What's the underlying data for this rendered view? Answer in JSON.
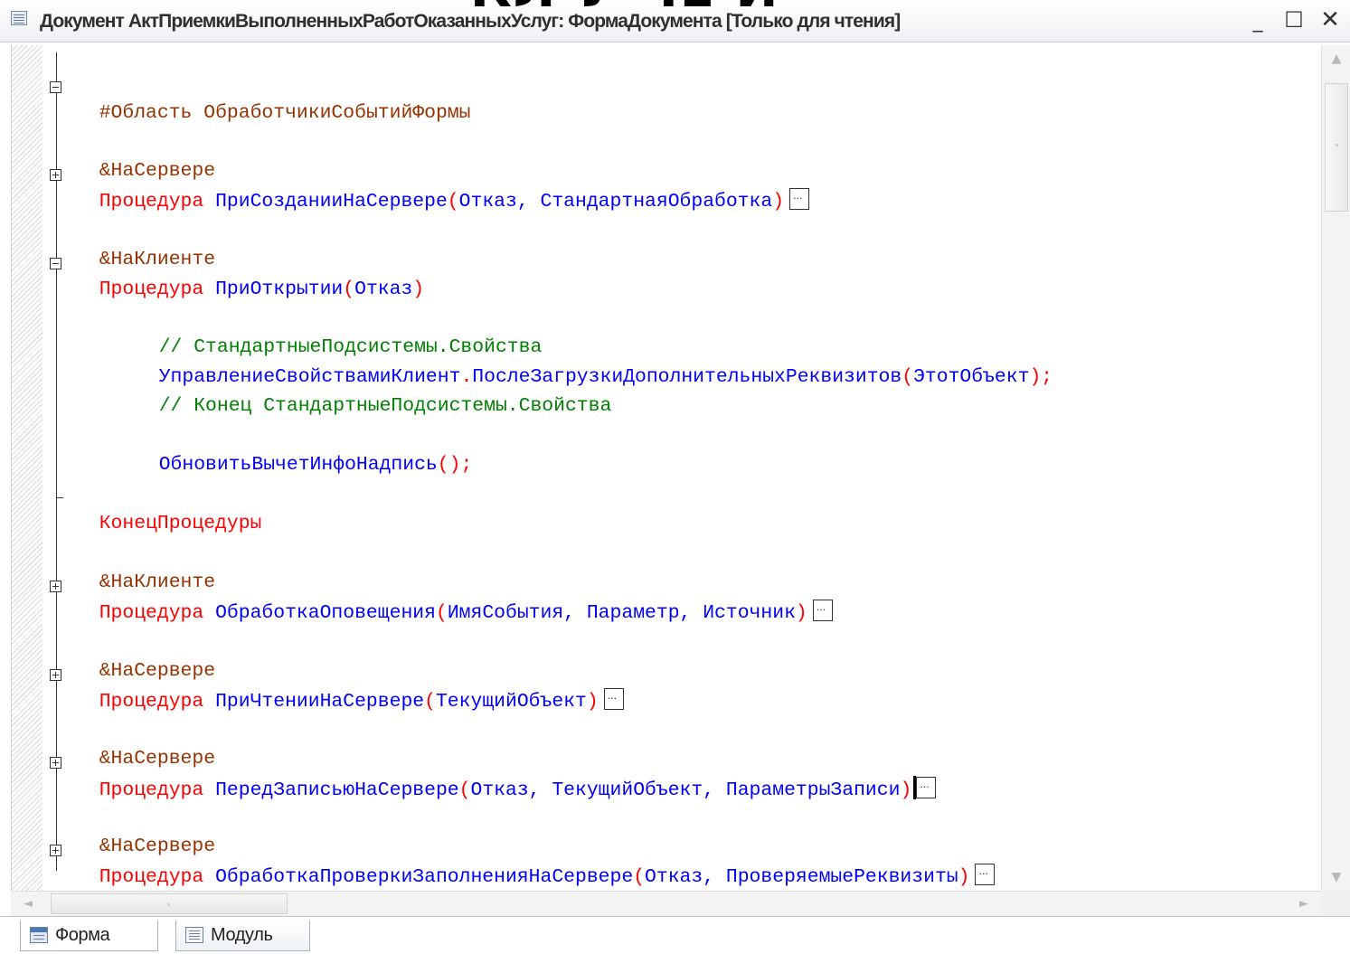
{
  "window": {
    "title": "Документ АктПриемкиВыполненныхРаботОказанныхУслуг: ФормаДокумента [Только для чтения]",
    "overlay_fragment": "КЛ У ЧЕ Й",
    "minimize": "_",
    "maximize": "☐",
    "close": "✕"
  },
  "code": {
    "l1": {
      "directive": "#Область",
      "name": "ОбработчикиСобытийФормы"
    },
    "l2": {
      "annotation": "&НаСервере"
    },
    "l3": {
      "kw": "Процедура",
      "name": "ПриСозданииНаСервере",
      "open": "(",
      "args": "Отказ, СтандартнаяОбработка",
      "close": ")"
    },
    "l4": {
      "annotation": "&НаКлиенте"
    },
    "l5": {
      "kw": "Процедура",
      "name": "ПриОткрытии",
      "open": "(",
      "args": "Отказ",
      "close": ")"
    },
    "l6": {
      "comment": "// СтандартныеПодсистемы.Свойства"
    },
    "l7": {
      "obj": "УправлениеСвойствамиКлиент",
      "dot": ".",
      "method": "ПослеЗагрузкиДополнительныхРеквизитов",
      "open": "(",
      "args": "ЭтотОбъект",
      "close": ");"
    },
    "l8": {
      "comment": "// Конец СтандартныеПодсистемы.Свойства"
    },
    "l9": {
      "call": "ОбновитьВычетИнфоНадпись",
      "paren": "();"
    },
    "l10": {
      "kw": "КонецПроцедуры"
    },
    "l11": {
      "annotation": "&НаКлиенте"
    },
    "l12": {
      "kw": "Процедура",
      "name": "ОбработкаОповещения",
      "open": "(",
      "args": "ИмяСобытия, Параметр, Источник",
      "close": ")"
    },
    "l13": {
      "annotation": "&НаСервере"
    },
    "l14": {
      "kw": "Процедура",
      "name": "ПриЧтенииНаСервере",
      "open": "(",
      "args": "ТекущийОбъект",
      "close": ")"
    },
    "l15": {
      "annotation": "&НаСервере"
    },
    "l16": {
      "kw": "Процедура",
      "name": "ПередЗаписьюНаСервере",
      "open": "(",
      "args": "Отказ, ТекущийОбъект, ПараметрыЗаписи",
      "close": ")"
    },
    "l17": {
      "annotation": "&НаСервере"
    },
    "l18": {
      "kw": "Процедура",
      "name": "ОбработкаПроверкиЗаполненияНаСервере",
      "open": "(",
      "args": "Отказ, ПроверяемыеРеквизиты",
      "close": ")"
    }
  },
  "scroll": {
    "up": "▲",
    "down": "▼",
    "left": "◄",
    "right": "►"
  },
  "tabs": {
    "form": "Форма",
    "module": "Модуль"
  }
}
